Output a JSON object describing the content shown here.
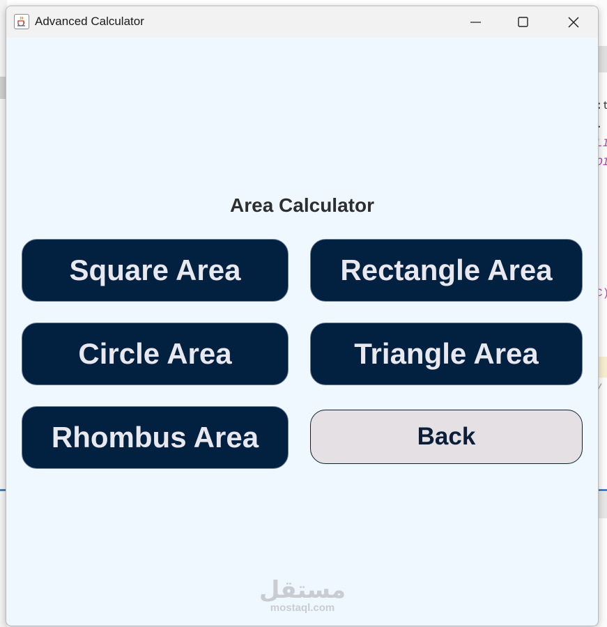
{
  "window": {
    "title": "Advanced Calculator"
  },
  "heading": "Area Calculator",
  "buttons": {
    "square": "Square Area",
    "rectangle": "Rectangle Area",
    "circle": "Circle Area",
    "triangle": "Triangle Area",
    "rhombus": "Rhombus Area",
    "back": "Back"
  },
  "watermark": {
    "arabic": "مستقل",
    "latin": "mostaql.com"
  },
  "background_fragments": [
    ":t",
    ".",
    "LI",
    "OI",
    "C)",
    "/"
  ],
  "icons": {
    "app": "java-cup-icon",
    "minimize": "minimize-icon",
    "maximize": "maximize-icon",
    "close": "close-icon"
  },
  "colors": {
    "window_bg": "#f0f8ff",
    "button_bg": "#022040",
    "button_text": "#e8e8ee",
    "back_bg": "#e4e0e3",
    "back_text": "#0b1f3a"
  }
}
